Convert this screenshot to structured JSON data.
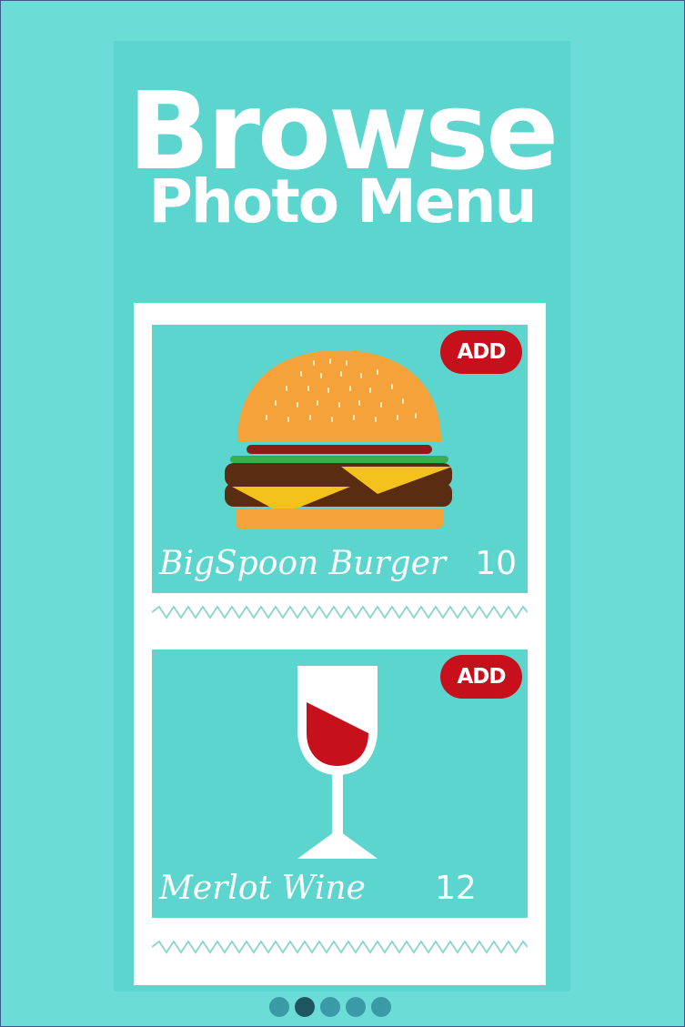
{
  "header": {
    "title_line1": "Browse",
    "title_line2": "Photo Menu"
  },
  "menu_items": [
    {
      "name": "BigSpoon Burger",
      "price": "10",
      "add_label": "ADD",
      "icon": "burger-icon"
    },
    {
      "name": "Merlot Wine",
      "price": "12",
      "add_label": "ADD",
      "icon": "wine-glass-icon"
    }
  ],
  "pagination": {
    "count": 5,
    "active_index": 1
  },
  "colors": {
    "background": "#6cdcd6",
    "panel": "#5dd5cf",
    "add_button": "#c6111c",
    "dot": "#3a9aa6",
    "dot_active": "#1f5560"
  }
}
